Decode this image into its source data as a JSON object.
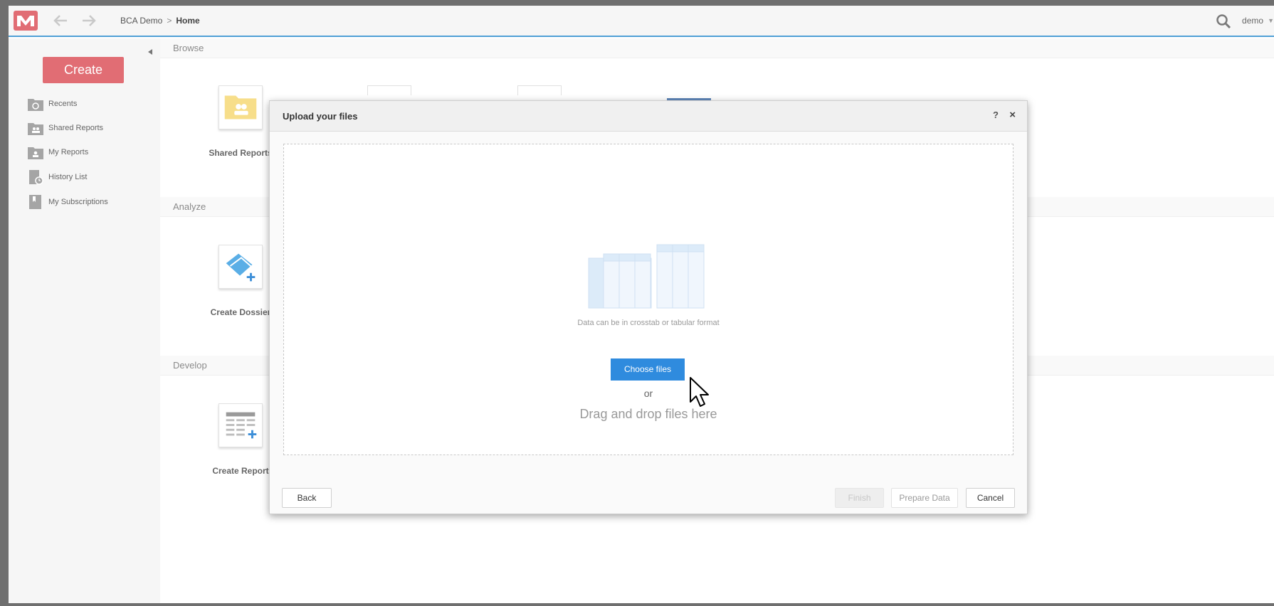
{
  "header": {
    "breadcrumb": [
      "BCA Demo",
      "Home"
    ],
    "breadcrumb_sep": ">",
    "user": "demo",
    "accent": "#4f9fd6"
  },
  "sidebar": {
    "create_label": "Create",
    "items": [
      {
        "label": "Recents",
        "icon": "recents-icon"
      },
      {
        "label": "Shared Reports",
        "icon": "shared-reports-icon"
      },
      {
        "label": "My Reports",
        "icon": "my-reports-icon"
      },
      {
        "label": "History List",
        "icon": "history-list-icon"
      },
      {
        "label": "My Subscriptions",
        "icon": "subscriptions-icon"
      }
    ]
  },
  "main": {
    "sections": [
      {
        "title": "Browse",
        "tile": "Shared Reports"
      },
      {
        "title": "Analyze",
        "tile": "Create Dossier"
      },
      {
        "title": "Develop",
        "tile": "Create Report"
      }
    ]
  },
  "modal": {
    "title": "Upload your files",
    "help": "?",
    "close": "×",
    "format_hint": "Data can be in crosstab or tabular format",
    "choose_files": "Choose files",
    "or": "or",
    "drag_drop": "Drag and drop files here",
    "back": "Back",
    "finish": "Finish",
    "prepare_data": "Prepare Data",
    "cancel": "Cancel",
    "primary_color": "#2f8bde"
  },
  "colors": {
    "create_button": "#e16d74",
    "logo": "#e16d74"
  }
}
